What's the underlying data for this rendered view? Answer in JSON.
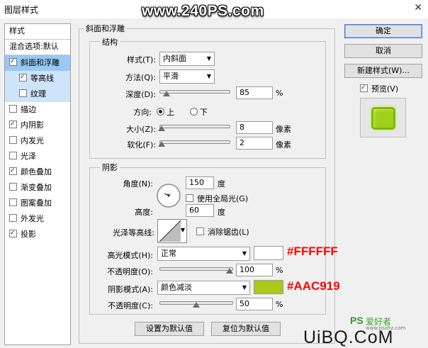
{
  "window": {
    "title": "图层样式",
    "close_glyph": "✕"
  },
  "watermark_top": "www.240PS.com",
  "style_list": {
    "header": "样式",
    "blend_options": "混合选项:默认",
    "items": [
      {
        "label": "斜面和浮雕",
        "checked": true
      },
      {
        "label": "等高线",
        "checked": true
      },
      {
        "label": "纹理",
        "checked": false
      },
      {
        "label": "描边",
        "checked": false
      },
      {
        "label": "内阴影",
        "checked": true
      },
      {
        "label": "内发光",
        "checked": false
      },
      {
        "label": "光泽",
        "checked": false
      },
      {
        "label": "颜色叠加",
        "checked": true
      },
      {
        "label": "渐变叠加",
        "checked": false
      },
      {
        "label": "图案叠加",
        "checked": false
      },
      {
        "label": "外发光",
        "checked": false
      },
      {
        "label": "投影",
        "checked": true
      }
    ]
  },
  "bevel": {
    "group_title": "斜面和浮雕",
    "structure_title": "结构",
    "style_label": "样式(T):",
    "style_value": "内斜面",
    "technique_label": "方法(Q):",
    "technique_value": "平滑",
    "depth_label": "深度(D):",
    "depth_value": "85",
    "depth_unit": "%",
    "direction_label": "方向:",
    "direction_up": "上",
    "direction_down": "下",
    "size_label": "大小(Z):",
    "size_value": "8",
    "size_unit": "像素",
    "soften_label": "软化(F):",
    "soften_value": "2",
    "soften_unit": "像素"
  },
  "shading": {
    "title": "阴影",
    "angle_label": "角度(N):",
    "angle_value": "150",
    "angle_unit": "度",
    "global_light_label": "使用全局光(G)",
    "altitude_label": "高度:",
    "altitude_value": "60",
    "altitude_unit": "度",
    "gloss_contour_label": "光泽等高线:",
    "antialias_label": "消除锯齿(L)",
    "highlight_mode_label": "高光模式(H):",
    "highlight_mode_value": "正常",
    "highlight_opacity_label": "不透明度(O):",
    "highlight_opacity_value": "100",
    "highlight_color": "#FFFFFF",
    "shadow_mode_label": "阴影模式(A):",
    "shadow_mode_value": "颜色减淡",
    "shadow_opacity_label": "不透明度(C):",
    "shadow_opacity_value": "50",
    "shadow_color": "#AAC919",
    "percent": "%"
  },
  "annotations": {
    "highlight": "#FFFFFF",
    "shadow": "#AAC919"
  },
  "footer": {
    "make_default": "设置为默认值",
    "reset_default": "复位为默认值"
  },
  "actions": {
    "ok": "确定",
    "cancel": "取消",
    "new_style": "新建样式(W)...",
    "preview": "预览(V)"
  },
  "watermark_bottom": {
    "ps": "PS",
    "cn": "爱好者",
    "site": "UiBQ.CoM",
    "url": "www.psahz.com"
  },
  "controls": {
    "depth_fraction": 0.1,
    "size_fraction": 0.03,
    "soften_fraction": 0.03,
    "highlight_opacity_fraction": 1.0,
    "shadow_opacity_fraction": 0.5
  }
}
